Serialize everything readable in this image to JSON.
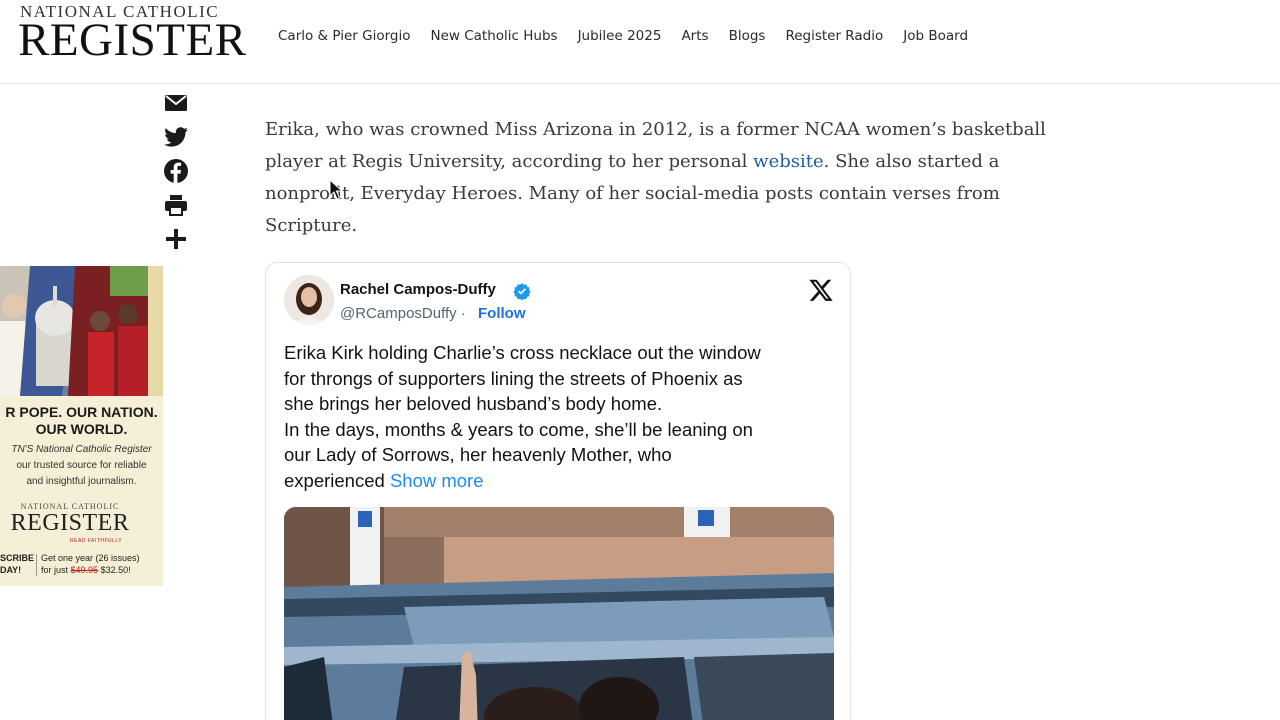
{
  "header": {
    "logo_top": "NATIONAL CATHOLIC",
    "logo_main": "REGISTER",
    "nav": [
      "Carlo & Pier Giorgio",
      "New Catholic Hubs",
      "Jubilee 2025",
      "Arts",
      "Blogs",
      "Register Radio",
      "Job Board"
    ]
  },
  "share": {
    "icons": [
      "email-icon",
      "twitter-icon",
      "facebook-icon",
      "print-icon",
      "plus-icon"
    ]
  },
  "ad": {
    "headline": "R POPE. OUR NATION.\nOUR WORLD.",
    "body_brand": "TN'S National Catholic Register",
    "body_rest": "our trusted source for reliable\nand insightful journalism.",
    "logo_top": "NATIONAL CATHOLIC",
    "logo_main": "REGISTER",
    "tagline": "READ FAITHFULLY",
    "subscribe": "SCRIBE\nDAY!",
    "offer_line1": "Get one year (26 issues)",
    "offer_prefix": "for just ",
    "old_price": "$49.95",
    "new_price": "$32.50!"
  },
  "article": {
    "text_before_link": "Erika, who was crowned Miss Arizona in 2012, is a former NCAA women’s basketball player at Regis University, according to her personal ",
    "link": "website",
    "text_after_link": ". She also started a nonprofit, Everyday Heroes. Many of her social-media posts contain verses from Scripture."
  },
  "tweet": {
    "name": "Rachel Campos-Duffy",
    "handle": "@RCamposDuffy",
    "separator": " · ",
    "follow": "Follow",
    "lines": [
      "Erika Kirk holding Charlie’s cross necklace out the window",
      "for throngs of supporters lining the streets of Phoenix as",
      "she brings her beloved husband’s body home.",
      "In the days, months & years to come, she’ll be leaning on",
      "our Lady of Sorrows, her heavenly Mother, who"
    ],
    "last_line": "experienced ",
    "show_more": "Show more"
  },
  "colors": {
    "link": "#1f5ea8",
    "follow": "#1d6fe0",
    "show_more": "#1d8bf0",
    "verified": "#1d9bf0"
  }
}
